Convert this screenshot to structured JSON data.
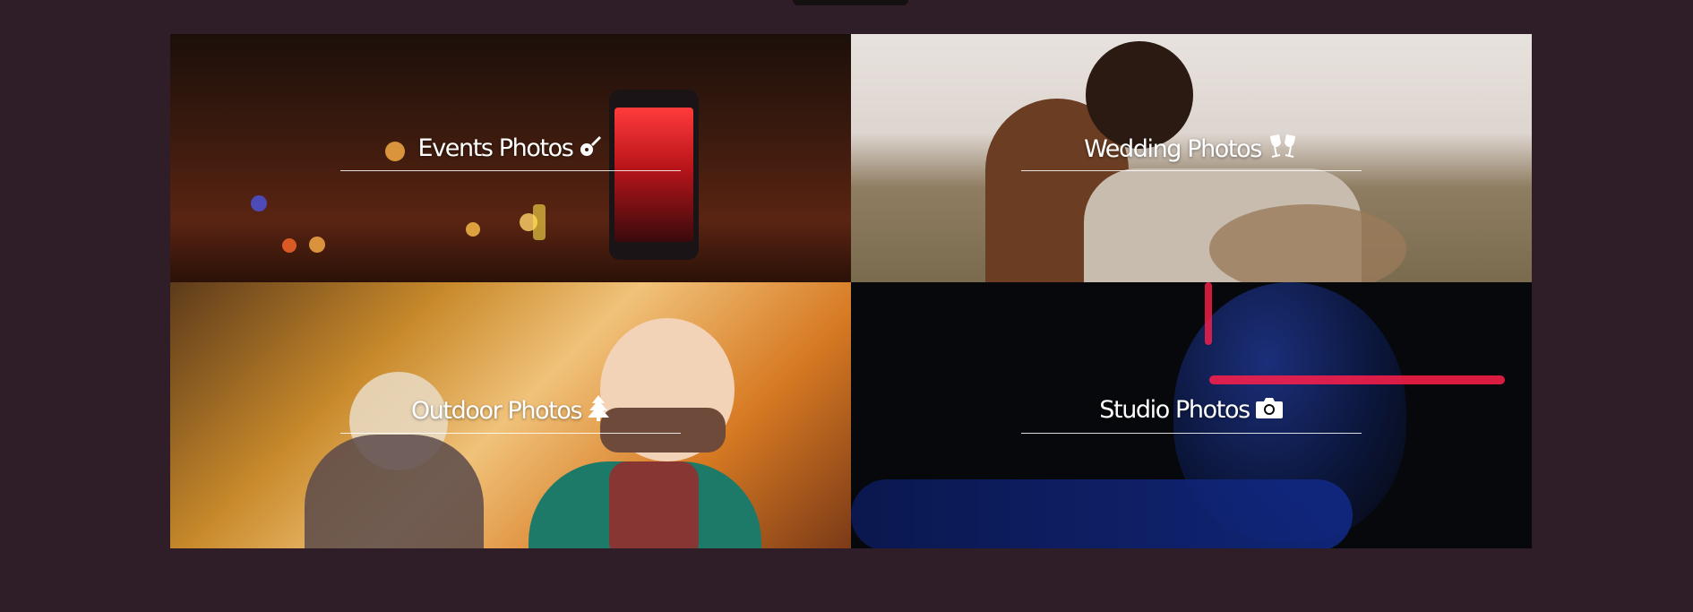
{
  "categories": [
    {
      "label": "Events Photos",
      "icon": "guitar-icon"
    },
    {
      "label": "Wedding Photos",
      "icon": "champagne-glasses-icon"
    },
    {
      "label": "Outdoor Photos",
      "icon": "tree-icon"
    },
    {
      "label": "Studio Photos",
      "icon": "camera-icon"
    }
  ],
  "colors": {
    "page_background": "#2f1d27",
    "caption_text": "#ffffff"
  }
}
